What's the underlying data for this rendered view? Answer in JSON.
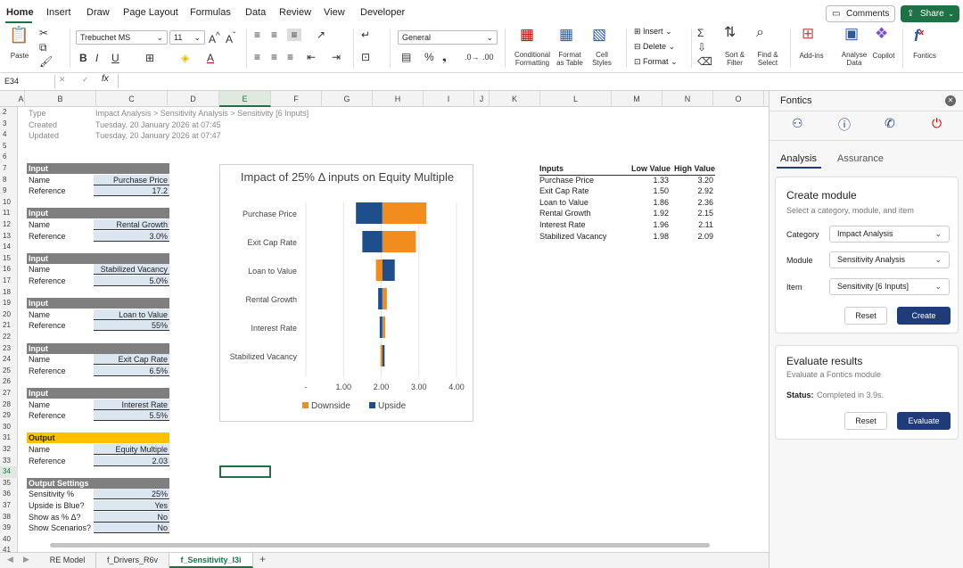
{
  "ribbon": {
    "tabs": [
      "Home",
      "Insert",
      "Draw",
      "Page Layout",
      "Formulas",
      "Data",
      "Review",
      "View",
      "Developer"
    ],
    "comments_label": "Comments",
    "share_label": "Share",
    "paste_label": "Paste",
    "font_name": "Trebuchet MS",
    "font_size": "11",
    "number_format": "General",
    "conditional_label1": "Conditional",
    "conditional_label2": "Formatting",
    "format_table_label1": "Format",
    "format_table_label2": "as Table",
    "cell_styles_label1": "Cell",
    "cell_styles_label2": "Styles",
    "insert_label": "Insert",
    "delete_label": "Delete",
    "format_label": "Format",
    "sort_label1": "Sort &",
    "sort_label2": "Filter",
    "find_label1": "Find &",
    "find_label2": "Select",
    "addins_label": "Add-ins",
    "analyse_label1": "Analyse",
    "analyse_label2": "Data",
    "copilot_label": "Copilot",
    "fontics_label": "Fontics"
  },
  "formula_bar": {
    "name_box": "E34",
    "fx": "fx",
    "value": ""
  },
  "columns": [
    "A",
    "B",
    "C",
    "D",
    "E",
    "F",
    "G",
    "H",
    "I",
    "J",
    "K",
    "L",
    "M",
    "N",
    "O"
  ],
  "selected_column": "E",
  "rows": [
    "2",
    "3",
    "4",
    "5",
    "6",
    "7",
    "8",
    "9",
    "10",
    "11",
    "12",
    "13",
    "14",
    "15",
    "16",
    "17",
    "18",
    "19",
    "20",
    "21",
    "22",
    "23",
    "24",
    "25",
    "26",
    "27",
    "28",
    "29",
    "30",
    "31",
    "32",
    "33",
    "34",
    "35",
    "36",
    "37",
    "38",
    "39",
    "40",
    "41"
  ],
  "selected_row": "34",
  "meta": {
    "type_label": "Type",
    "type_value": "Impact Analysis > Sensitivity Analysis > Sensitivity [6 Inputs]",
    "created_label": "Created",
    "created_value": "Tuesday, 20 January 2026 at 07:45",
    "updated_label": "Updated",
    "updated_value": "Tuesday, 20 January 2026 at 07:47"
  },
  "inputs": [
    {
      "header": "Input",
      "name_label": "Name",
      "name": "Purchase Price",
      "ref_label": "Reference",
      "ref": "17.2"
    },
    {
      "header": "Input",
      "name_label": "Name",
      "name": "Rental Growth",
      "ref_label": "Reference",
      "ref": "3.0%"
    },
    {
      "header": "Input",
      "name_label": "Name",
      "name": "Stabilized Vacancy",
      "ref_label": "Reference",
      "ref": "5.0%"
    },
    {
      "header": "Input",
      "name_label": "Name",
      "name": "Loan to Value",
      "ref_label": "Reference",
      "ref": "55%"
    },
    {
      "header": "Input",
      "name_label": "Name",
      "name": "Exit Cap Rate",
      "ref_label": "Reference",
      "ref": "6.5%"
    },
    {
      "header": "Input",
      "name_label": "Name",
      "name": "Interest Rate",
      "ref_label": "Reference",
      "ref": "5.5%"
    },
    {
      "header": "Output",
      "name_label": "Name",
      "name": "Equity Multiple",
      "ref_label": "Reference",
      "ref": "2.03"
    }
  ],
  "output_settings": {
    "header": "Output Settings",
    "rows": [
      {
        "label": "Sensitivity %",
        "value": "25%"
      },
      {
        "label": "Upside is Blue?",
        "value": "Yes"
      },
      {
        "label": "Show as % Δ?",
        "value": "No"
      },
      {
        "label": "Show Scenarios?",
        "value": "No"
      }
    ]
  },
  "table": {
    "headers": [
      "Inputs",
      "Low Value",
      "High Value"
    ],
    "rows": [
      [
        "Purchase Price",
        "1.33",
        "3.20"
      ],
      [
        "Exit Cap Rate",
        "1.50",
        "2.92"
      ],
      [
        "Loan to Value",
        "1.86",
        "2.36"
      ],
      [
        "Rental Growth",
        "1.92",
        "2.15"
      ],
      [
        "Interest Rate",
        "1.96",
        "2.11"
      ],
      [
        "Stabilized Vacancy",
        "1.98",
        "2.09"
      ]
    ]
  },
  "chart_data": {
    "type": "bar",
    "orientation": "horizontal",
    "title": "Impact of 25% Δ inputs on Equity Multiple",
    "base": 2.03,
    "categories": [
      "Purchase Price",
      "Exit Cap Rate",
      "Loan to Value",
      "Rental Growth",
      "Interest Rate",
      "Stabilized Vacancy"
    ],
    "series": [
      {
        "name": "Downside",
        "color": "#f28c1f",
        "values": [
          3.2,
          2.92,
          1.86,
          2.15,
          2.11,
          1.98
        ]
      },
      {
        "name": "Upside",
        "color": "#1f4e8c",
        "values": [
          1.33,
          1.5,
          2.36,
          1.92,
          1.96,
          2.09
        ]
      }
    ],
    "xtick_labels": [
      "-",
      "1.00",
      "2.00",
      "3.00",
      "4.00"
    ],
    "xlim": [
      0,
      4
    ],
    "grid": true,
    "legend": "bottom"
  },
  "sheets": {
    "tabs": [
      "RE Model",
      "f_Drivers_R6v",
      "f_Sensitivity_I3i"
    ],
    "active": "f_Sensitivity_I3i",
    "add": "+"
  },
  "pane": {
    "title": "Fontics",
    "tabs": [
      "Analysis",
      "Assurance"
    ],
    "create": {
      "title": "Create module",
      "subtitle": "Select a category, module, and item",
      "category_label": "Category",
      "category_value": "Impact Analysis",
      "module_label": "Module",
      "module_value": "Sensitivity Analysis",
      "item_label": "Item",
      "item_value": "Sensitivity [6 Inputs]",
      "reset": "Reset",
      "create": "Create"
    },
    "evaluate": {
      "title": "Evaluate results",
      "subtitle": "Evaluate a Fontics module",
      "status_label": "Status:",
      "status_value": "Completed in 3.9s.",
      "reset": "Reset",
      "evaluate": "Evaluate"
    }
  },
  "colors": {
    "accent": "#1e7145",
    "primary_button": "#1f3b7a",
    "downside": "#f28c1f",
    "upside": "#1f4e8c",
    "output": "#ffc000"
  }
}
